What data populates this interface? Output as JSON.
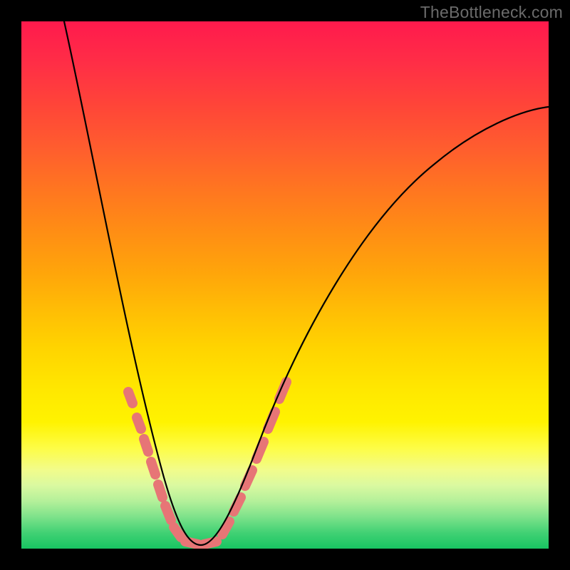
{
  "watermark": "TheBottleneck.com",
  "colors": {
    "gradient_top": "#ff1a4d",
    "gradient_mid": "#ffd400",
    "gradient_bottom": "#18c562",
    "curve": "#000000",
    "dots": "#e77576",
    "frame": "#000000"
  },
  "chart_data": {
    "type": "line",
    "title": "",
    "xlabel": "",
    "ylabel": "",
    "xlim": [
      0,
      100
    ],
    "ylim": [
      0,
      100
    ],
    "x": [
      0,
      5,
      10,
      15,
      20,
      25,
      30,
      35,
      40,
      45,
      50,
      55,
      60,
      65,
      70,
      75,
      80,
      85,
      90,
      95,
      100
    ],
    "series": [
      {
        "name": "bottleneck-curve",
        "values": [
          100,
          82,
          66,
          51,
          38,
          26,
          15,
          6,
          1,
          3,
          11,
          22,
          33,
          43,
          52,
          59,
          65,
          70,
          74,
          77,
          80
        ]
      }
    ],
    "annotations": {
      "dotted_region_x": [
        20,
        50
      ],
      "dotted_region_note": "pink dotted overlay near minimum"
    }
  }
}
